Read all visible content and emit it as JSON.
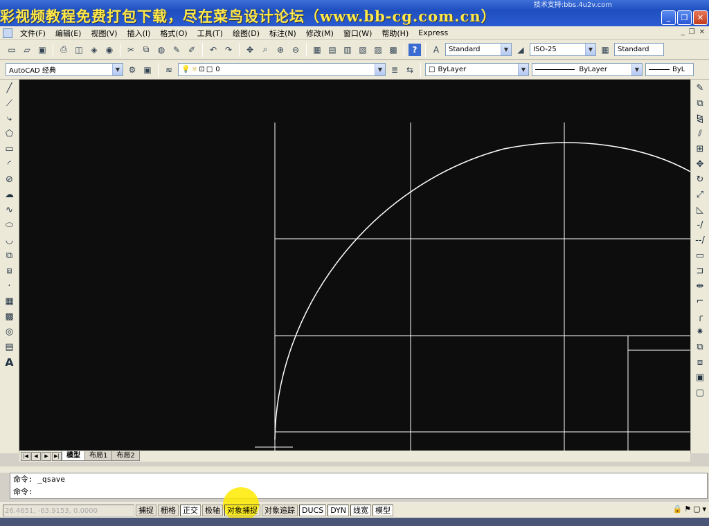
{
  "watermark": "彩视频教程免费打包下载，尽在菜鸟设计论坛（www.bb-cg.com.cn）",
  "support_text": "技术支持:bbs.4u2v.com",
  "menu": [
    "文件(F)",
    "编辑(E)",
    "视图(V)",
    "插入(I)",
    "格式(O)",
    "工具(T)",
    "绘图(D)",
    "标注(N)",
    "修改(M)",
    "窗口(W)",
    "帮助(H)",
    "Express"
  ],
  "styles": {
    "text_style": "Standard",
    "dim_style": "ISO-25",
    "table_style": "Standard"
  },
  "workspace": "AutoCAD 经典",
  "layer": "0",
  "properties": {
    "color": "ByLayer",
    "linetype": "ByLayer",
    "lineweight": "ByL"
  },
  "layout_tabs": [
    "模型",
    "布局1",
    "布局2"
  ],
  "command": {
    "history": "命令:  _qsave",
    "prompt": "命令:"
  },
  "coords": "26.4651, -63.9153, 0.0000",
  "status_buttons": [
    "捕捉",
    "栅格",
    "正交",
    "极轴",
    "对象捕捉",
    "对象追踪",
    "DUCS",
    "DYN",
    "线宽",
    "模型"
  ],
  "status_on": [
    "正交",
    "对象捕捉",
    "DUCS",
    "DYN",
    "线宽",
    "模型"
  ],
  "colors": {
    "canvas": "#0d0d0d",
    "lines": "#ffffff",
    "highlight": "#ffeb00"
  }
}
